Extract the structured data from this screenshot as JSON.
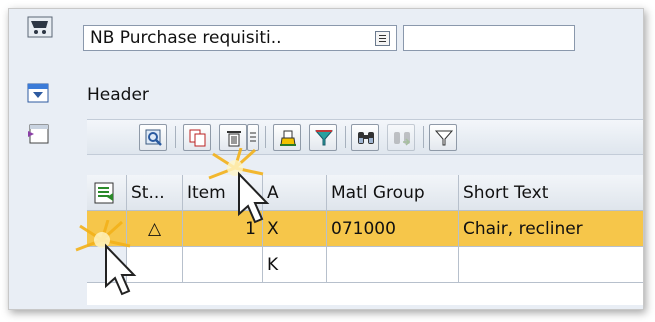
{
  "doc": {
    "type_label": "NB Purchase requisiti..",
    "cart_icon": "shopping-cart-icon"
  },
  "header": {
    "label": "Header"
  },
  "toolbar": {
    "buttons": [
      "details-icon",
      "copy-icon",
      "delete-icon",
      "print-icon",
      "filter-icon",
      "find-icon",
      "find-next-icon",
      "set-filter-icon"
    ]
  },
  "table": {
    "columns": [
      "St...",
      "Item",
      "A",
      "Matl Group",
      "Short Text"
    ],
    "rows": [
      {
        "status": "△",
        "item": "1",
        "a": "X",
        "matl_group": "071000",
        "short_text": "Chair, recliner"
      },
      {
        "status": "",
        "item": "",
        "a": "K",
        "matl_group": "",
        "short_text": ""
      }
    ]
  },
  "colors": {
    "selected_row": "#f6c64a",
    "frame_bg": "#e9eef5"
  }
}
